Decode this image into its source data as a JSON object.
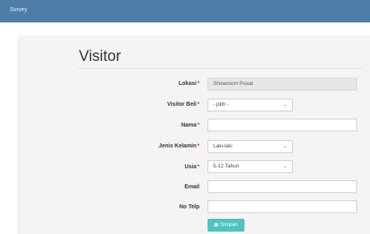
{
  "navbar": {
    "brand": "Survey"
  },
  "page": {
    "title": "Visitor"
  },
  "form": {
    "lokasi": {
      "label": "Lokasi",
      "required_mark": "*",
      "value": "Showroom Pusat"
    },
    "visitor_beli": {
      "label": "Visitor Beli",
      "required_mark": "*",
      "value": "- pilih -"
    },
    "nama": {
      "label": "Nama",
      "required_mark": "*",
      "value": ""
    },
    "jenis_kelamin": {
      "label": "Jenis Kelamin",
      "required_mark": "*",
      "value": "Laki-laki"
    },
    "usia": {
      "label": "Usia",
      "required_mark": "*",
      "value": "5-12 Tahun"
    },
    "email": {
      "label": "Email",
      "value": ""
    },
    "no_telp": {
      "label": "No Telp",
      "value": ""
    }
  },
  "submit": {
    "icon": "save-icon",
    "label": "Simpan"
  },
  "colors": {
    "navbar": "#4d7ea8",
    "button": "#4ec3c0"
  }
}
